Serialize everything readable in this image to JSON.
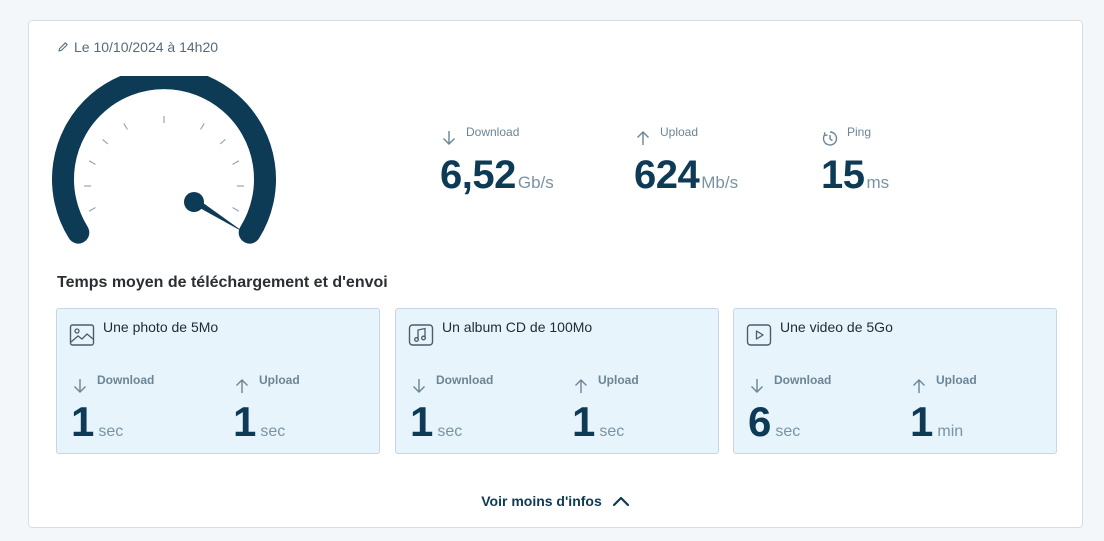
{
  "header": {
    "date_text": "Le 10/10/2024 à 14h20",
    "edit_icon": "pencil-icon"
  },
  "gauge": {
    "icon": "speedometer-icon"
  },
  "results": {
    "download": {
      "label": "Download",
      "value": "6,52",
      "unit": "Gb/s",
      "icon": "arrow-down-icon"
    },
    "upload": {
      "label": "Upload",
      "value": "624",
      "unit": "Mb/s",
      "icon": "arrow-up-icon"
    },
    "ping": {
      "label": "Ping",
      "value": "15",
      "unit": "ms",
      "icon": "ping-icon"
    }
  },
  "section": {
    "title": "Temps moyen de téléchargement et d'envoi"
  },
  "tiles": [
    {
      "title": "Une photo de 5Mo",
      "icon": "image-icon",
      "download": {
        "label": "Download",
        "value": "1",
        "unit": "sec"
      },
      "upload": {
        "label": "Upload",
        "value": "1",
        "unit": "sec"
      }
    },
    {
      "title": "Un album CD de 100Mo",
      "icon": "music-icon",
      "download": {
        "label": "Download",
        "value": "1",
        "unit": "sec"
      },
      "upload": {
        "label": "Upload",
        "value": "1",
        "unit": "sec"
      }
    },
    {
      "title": "Une video de 5Go",
      "icon": "video-icon",
      "download": {
        "label": "Download",
        "value": "6",
        "unit": "sec"
      },
      "upload": {
        "label": "Upload",
        "value": "1",
        "unit": "min"
      }
    }
  ],
  "footer": {
    "toggle_label": "Voir moins d'infos",
    "icon": "chevron-up-icon"
  },
  "colors": {
    "primary": "#0d3a55",
    "muted": "#7a93a3",
    "tile_bg": "#e8f4fc"
  }
}
